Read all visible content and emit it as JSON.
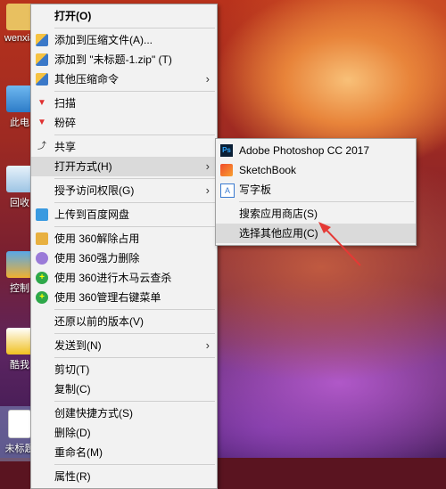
{
  "desktop": {
    "icons": [
      {
        "label": "wenxia"
      },
      {
        "label": "此电"
      },
      {
        "label": "回收"
      },
      {
        "label": "控制"
      },
      {
        "label": "酷我"
      },
      {
        "label": "未标题"
      }
    ]
  },
  "context_menu": {
    "open": "打开(O)",
    "add_archive": "添加到压缩文件(A)...",
    "add_zip": "添加到 \"未标题-1.zip\" (T)",
    "other_compress": "其他压缩命令",
    "scan": "扫描",
    "shred": "粉碎",
    "share": "共享",
    "open_with": "打开方式(H)",
    "grant_access": "授予访问权限(G)",
    "upload_baidu": "上传到百度网盘",
    "unlock_360": "使用 360解除占用",
    "force_delete_360": "使用 360强力删除",
    "trojan_scan_360": "使用 360进行木马云查杀",
    "manage_menu_360": "使用 360管理右键菜单",
    "restore_version": "还原以前的版本(V)",
    "send_to": "发送到(N)",
    "cut": "剪切(T)",
    "copy": "复制(C)",
    "create_shortcut": "创建快捷方式(S)",
    "delete": "删除(D)",
    "rename": "重命名(M)",
    "properties": "属性(R)"
  },
  "submenu": {
    "photoshop": "Adobe Photoshop CC 2017",
    "sketchbook": "SketchBook",
    "wordpad": "写字板",
    "search_store": "搜索应用商店(S)",
    "choose_other": "选择其他应用(C)"
  },
  "colors": {
    "annotation_arrow": "#e53935",
    "menu_bg": "#f2f2f2",
    "highlight": "#dadada"
  }
}
